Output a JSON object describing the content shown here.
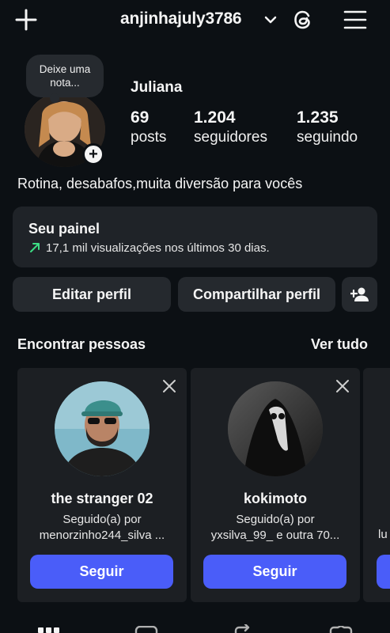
{
  "header": {
    "username": "anjinhajuly3786"
  },
  "profile": {
    "note_text": "Deixe uma nota...",
    "display_name": "Juliana",
    "stats": [
      {
        "value": "69",
        "label": "posts"
      },
      {
        "value": "1.204",
        "label": "seguidores"
      },
      {
        "value": "1.235",
        "label": "seguindo"
      }
    ],
    "bio": "Rotina, desabafos,muita diversão para vocês"
  },
  "dashboard": {
    "title": "Seu painel",
    "subtitle": "17,1 mil visualizações nos últimos 30 dias."
  },
  "actions": {
    "edit_label": "Editar perfil",
    "share_label": "Compartilhar perfil"
  },
  "suggestions": {
    "title": "Encontrar pessoas",
    "see_all": "Ver tudo",
    "cards": [
      {
        "name": "the stranger 02",
        "line1": "Seguido(a) por",
        "line2": "menorzinho244_silva ...",
        "button": "Seguir"
      },
      {
        "name": "kokimoto",
        "line1": "Seguido(a) por",
        "line2": "yxsilva_99_ e outra 70...",
        "button": "Seguir"
      }
    ],
    "partial_card_text": "lu"
  },
  "colors": {
    "background": "#0c1014",
    "card": "#1c1f23",
    "button": "#25292e",
    "accent": "#4a5df9",
    "trend_green": "#3ddc84"
  }
}
